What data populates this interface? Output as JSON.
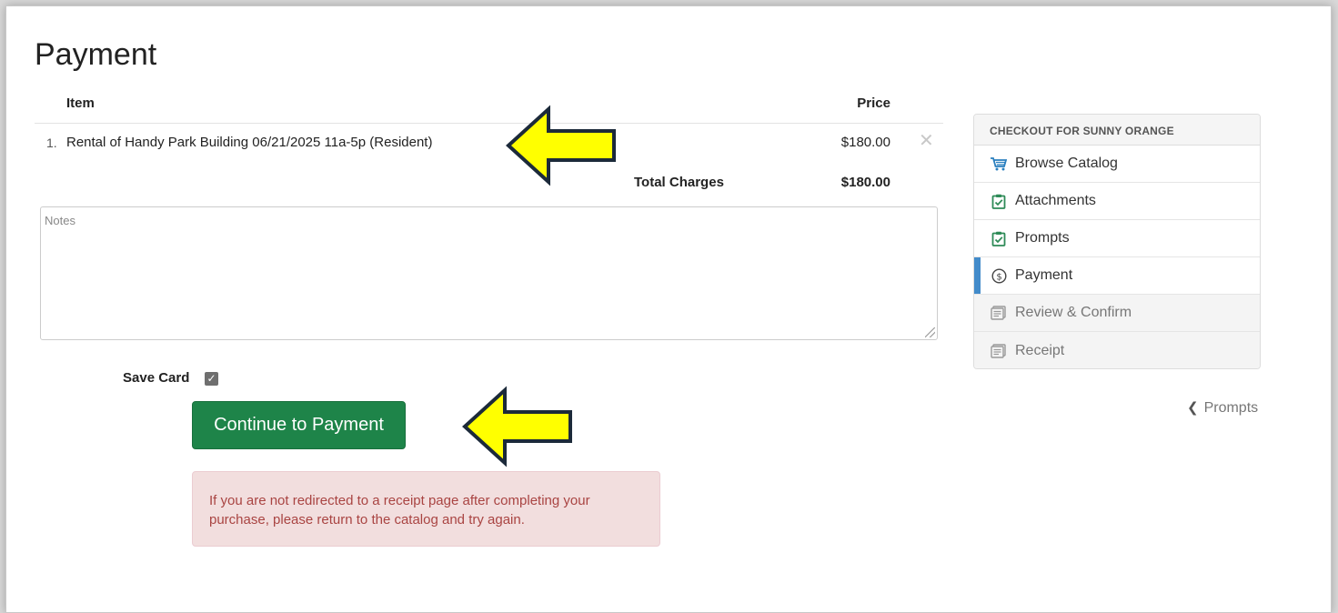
{
  "page": {
    "title": "Payment"
  },
  "cart": {
    "col_item": "Item",
    "col_price": "Price",
    "items": [
      {
        "num": "1.",
        "description": "Rental of Handy Park Building 06/21/2025 11a-5p (Resident)",
        "price": "$180.00",
        "remove_glyph": "✕"
      }
    ],
    "total_label": "Total Charges",
    "total_value": "$180.00"
  },
  "notes": {
    "placeholder": "Notes",
    "value": ""
  },
  "save_card": {
    "label": "Save Card",
    "checked": true,
    "check_glyph": "✓"
  },
  "continue_button": {
    "label": "Continue to Payment"
  },
  "alert": {
    "text": "If you are not redirected to a receipt page after completing your purchase, please return to the catalog and try again."
  },
  "sidebar": {
    "heading": "CHECKOUT FOR SUNNY ORANGE",
    "items": [
      {
        "label": "Browse Catalog",
        "icon": "cart-icon",
        "state": "complete"
      },
      {
        "label": "Attachments",
        "icon": "clipboard-check-icon",
        "state": "complete"
      },
      {
        "label": "Prompts",
        "icon": "clipboard-check-icon",
        "state": "complete"
      },
      {
        "label": "Payment",
        "icon": "dollar-circle-icon",
        "state": "active"
      },
      {
        "label": "Review & Confirm",
        "icon": "receipt-icon",
        "state": "disabled"
      },
      {
        "label": "Receipt",
        "icon": "receipt-icon",
        "state": "disabled"
      }
    ]
  },
  "back_link": {
    "label": "Prompts",
    "icon": "chevron-left-icon"
  },
  "colors": {
    "primary_button": "#1e8449",
    "active_accent": "#428bca",
    "alert_bg": "#f2dede",
    "alert_text": "#a94442",
    "annotation_arrow": "#ffff00",
    "complete_icon": "#2e8b57",
    "cart_icon": "#2a7fbf"
  }
}
